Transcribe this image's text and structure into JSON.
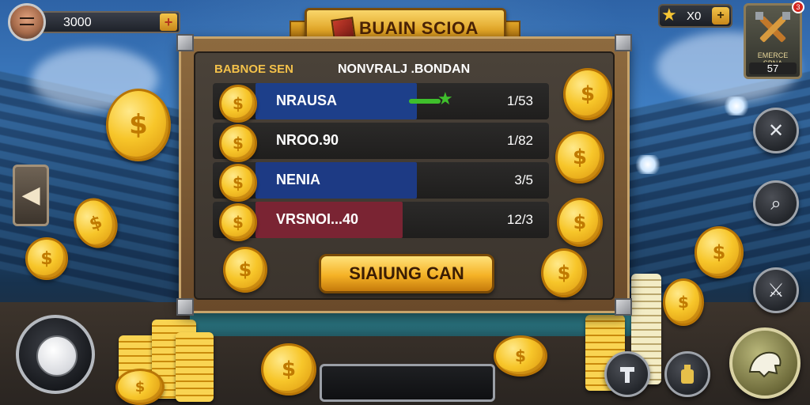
{
  "header": {
    "currency_value": "3000",
    "currency_plus": "+",
    "title": "BUAIN SCIOA",
    "stars_value": "X0",
    "stars_plus": "+",
    "tools_label": "EMERCE SBNA",
    "tools_value": "57",
    "notification_count": "3"
  },
  "panel": {
    "column_left_header": "BABNOE SEN",
    "column_center_header": "NONVRALJ .BONDAN",
    "rows": [
      {
        "name": "NRAUSA",
        "score": "1/53",
        "fill_fraction": 0.55,
        "fill_color": "#1d3f8a",
        "has_progress": true
      },
      {
        "name": "NROO.90",
        "score": "1/82",
        "fill_fraction": 0.0,
        "fill_color": "#1d3f8a",
        "has_progress": false
      },
      {
        "name": "NENIA",
        "score": "3/5",
        "fill_fraction": 0.55,
        "fill_color": "#1d3a84",
        "has_progress": false
      },
      {
        "name": "VRSNOI...40",
        "score": "12/3",
        "fill_fraction": 0.5,
        "fill_color": "#7a2433",
        "has_progress": false
      }
    ],
    "claim_button": "SIAIUNG CAN"
  },
  "controls": {
    "left_arrow": "◀",
    "close_icon_glyph": "✕",
    "search_icon_glyph": "⌕",
    "sword_icon_glyph": "⚔"
  },
  "colors": {
    "accent_gold": "#f5b226",
    "progress_green": "#3fbf2c",
    "row_blue": "#1d3f8a",
    "row_red": "#7a2433"
  }
}
